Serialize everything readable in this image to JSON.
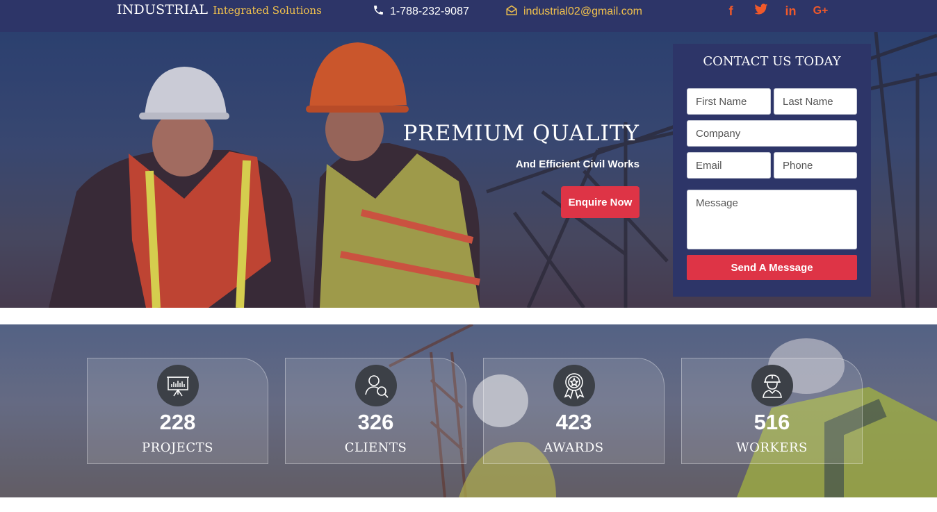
{
  "header": {
    "brand_main": "INDUSTRIAL",
    "brand_sub": "Integrated Solutions",
    "phone": "1-788-232-9087",
    "email": "industrial02@gmail.com",
    "socials": [
      {
        "name": "facebook",
        "glyph": "f"
      },
      {
        "name": "twitter",
        "glyph": "t"
      },
      {
        "name": "linkedin",
        "glyph": "in"
      },
      {
        "name": "google-plus",
        "glyph": "G+"
      }
    ],
    "accent_color": "#f2c24d",
    "social_color": "#f0592a"
  },
  "hero": {
    "title": "PREMIUM QUALITY",
    "subtitle": "And Efficient Civil Works",
    "cta_label": "Enquire Now"
  },
  "form": {
    "title": "CONTACT US TODAY",
    "first_name": "First Name",
    "last_name": "Last Name",
    "company": "Company",
    "email": "Email",
    "phone": "Phone",
    "message": "Message",
    "submit_label": "Send A Message",
    "button_color": "#de3446"
  },
  "stats": [
    {
      "icon": "presentation-board-icon",
      "value": "228",
      "label": "PROJECTS"
    },
    {
      "icon": "user-search-icon",
      "value": "326",
      "label": "CLIENTS"
    },
    {
      "icon": "award-ribbon-icon",
      "value": "423",
      "label": "AWARDS"
    },
    {
      "icon": "worker-helmet-icon",
      "value": "516",
      "label": "WORKERS"
    }
  ]
}
